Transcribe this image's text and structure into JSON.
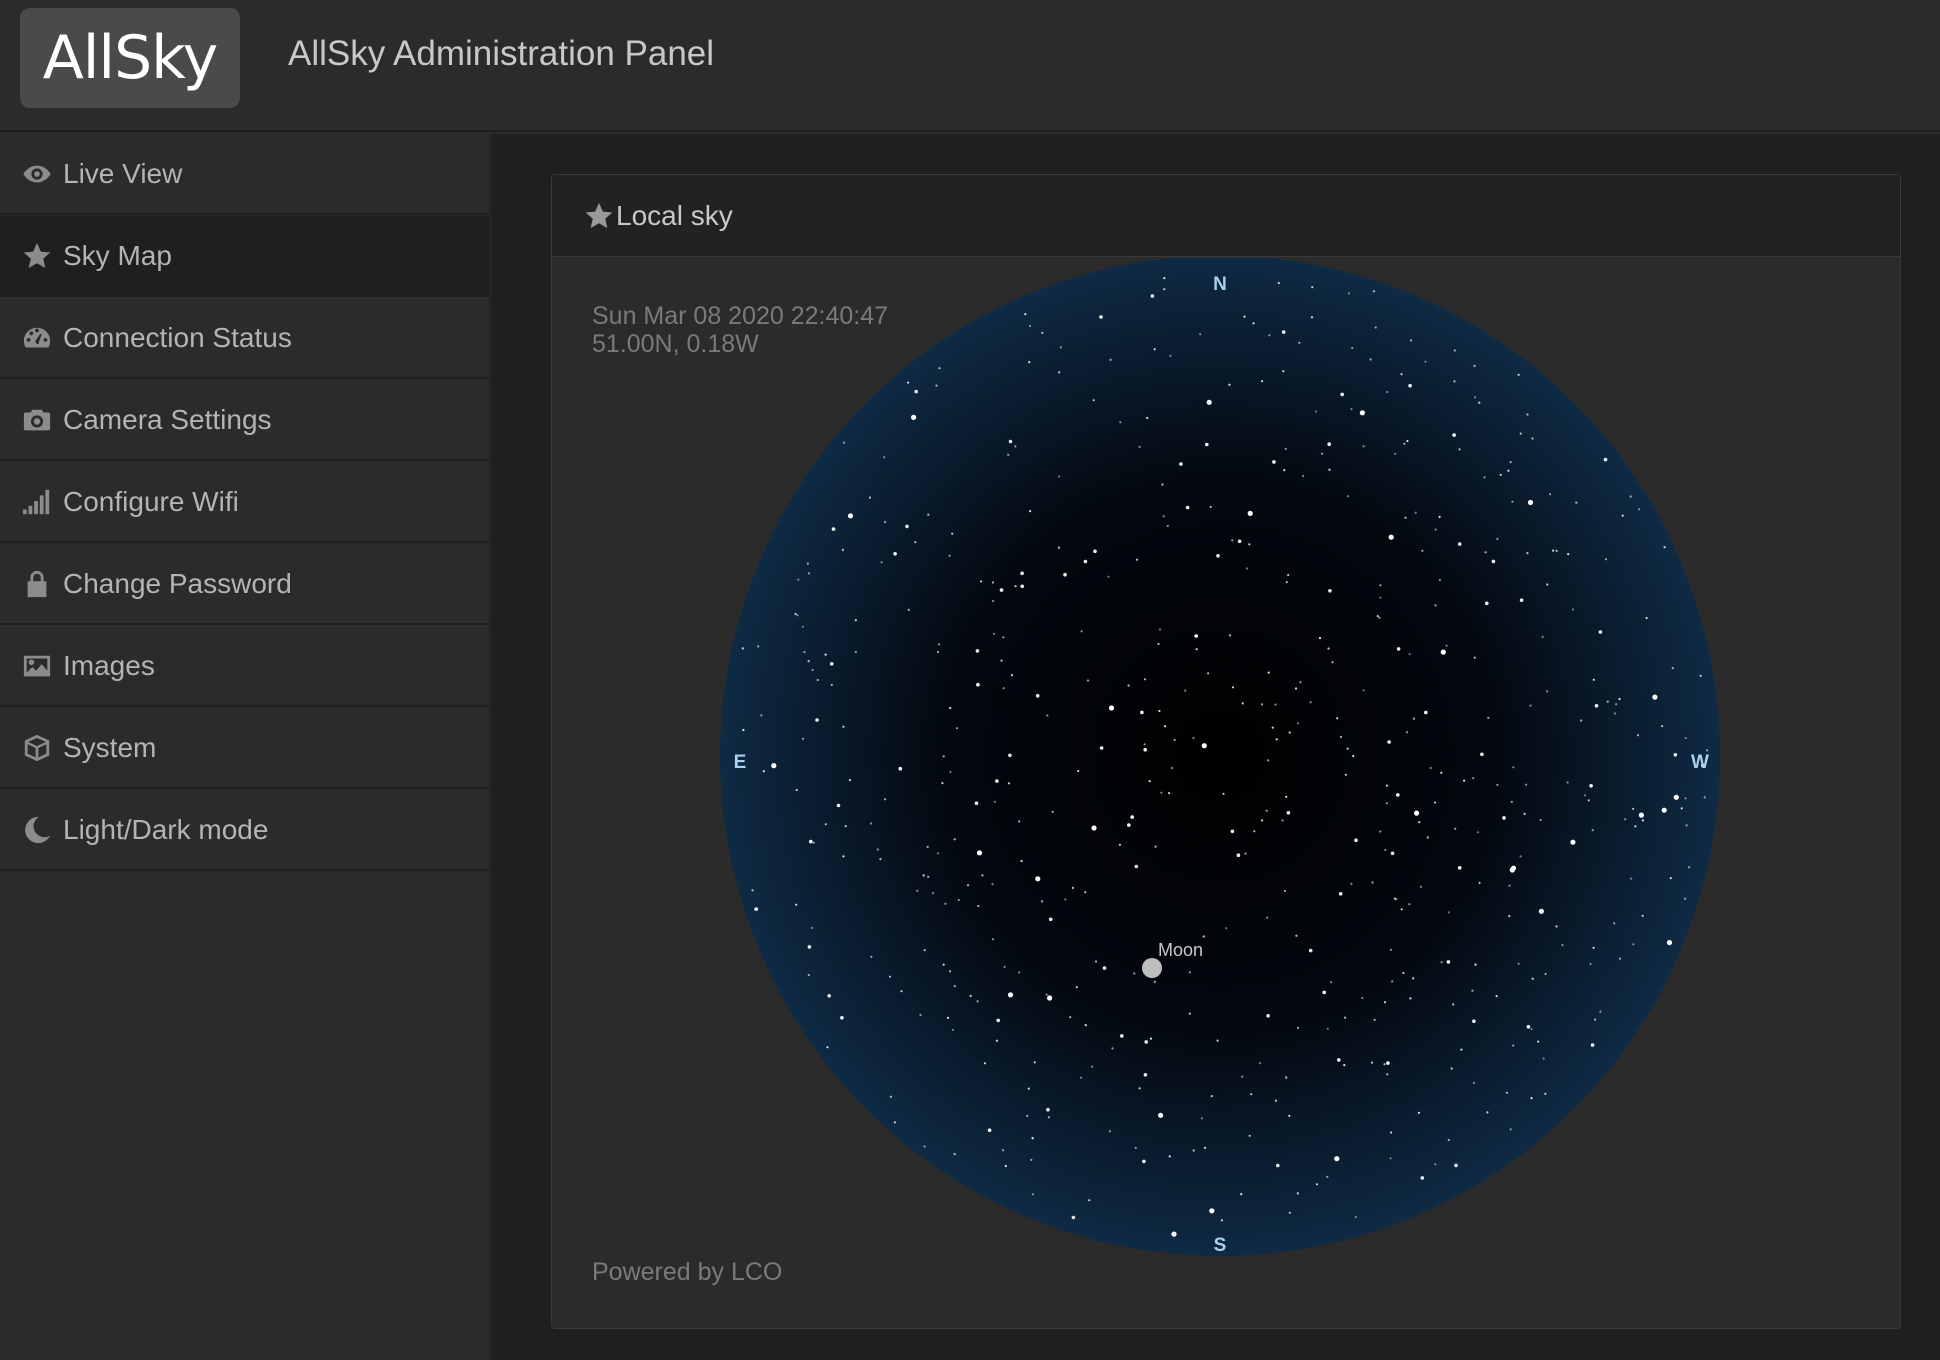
{
  "header": {
    "logo_text": "AllSky",
    "title": "AllSky Administration Panel"
  },
  "sidebar": {
    "items": [
      {
        "label": "Live View",
        "icon": "eye-icon"
      },
      {
        "label": "Sky Map",
        "icon": "star-icon",
        "active": true
      },
      {
        "label": "Connection Status",
        "icon": "dashboard-icon"
      },
      {
        "label": "Camera Settings",
        "icon": "camera-icon"
      },
      {
        "label": "Configure Wifi",
        "icon": "signal-icon"
      },
      {
        "label": "Change Password",
        "icon": "lock-icon"
      },
      {
        "label": "Images",
        "icon": "image-icon"
      },
      {
        "label": "System",
        "icon": "box-icon"
      },
      {
        "label": "Light/Dark mode",
        "icon": "moon-icon"
      }
    ]
  },
  "main": {
    "card_title": "Local sky",
    "datetime": "Sun Mar 08 2020 22:40:47",
    "location": "51.00N, 0.18W",
    "powered_by": "Powered by LCO",
    "compass": {
      "north": "N",
      "south": "S",
      "east": "E",
      "west": "W"
    },
    "moon_label": "Moon"
  },
  "colors": {
    "sky_center": "#000000",
    "sky_edge": "#0f2a44",
    "compass_label": "#a9d0ec",
    "moon": "#bdbdbd"
  }
}
